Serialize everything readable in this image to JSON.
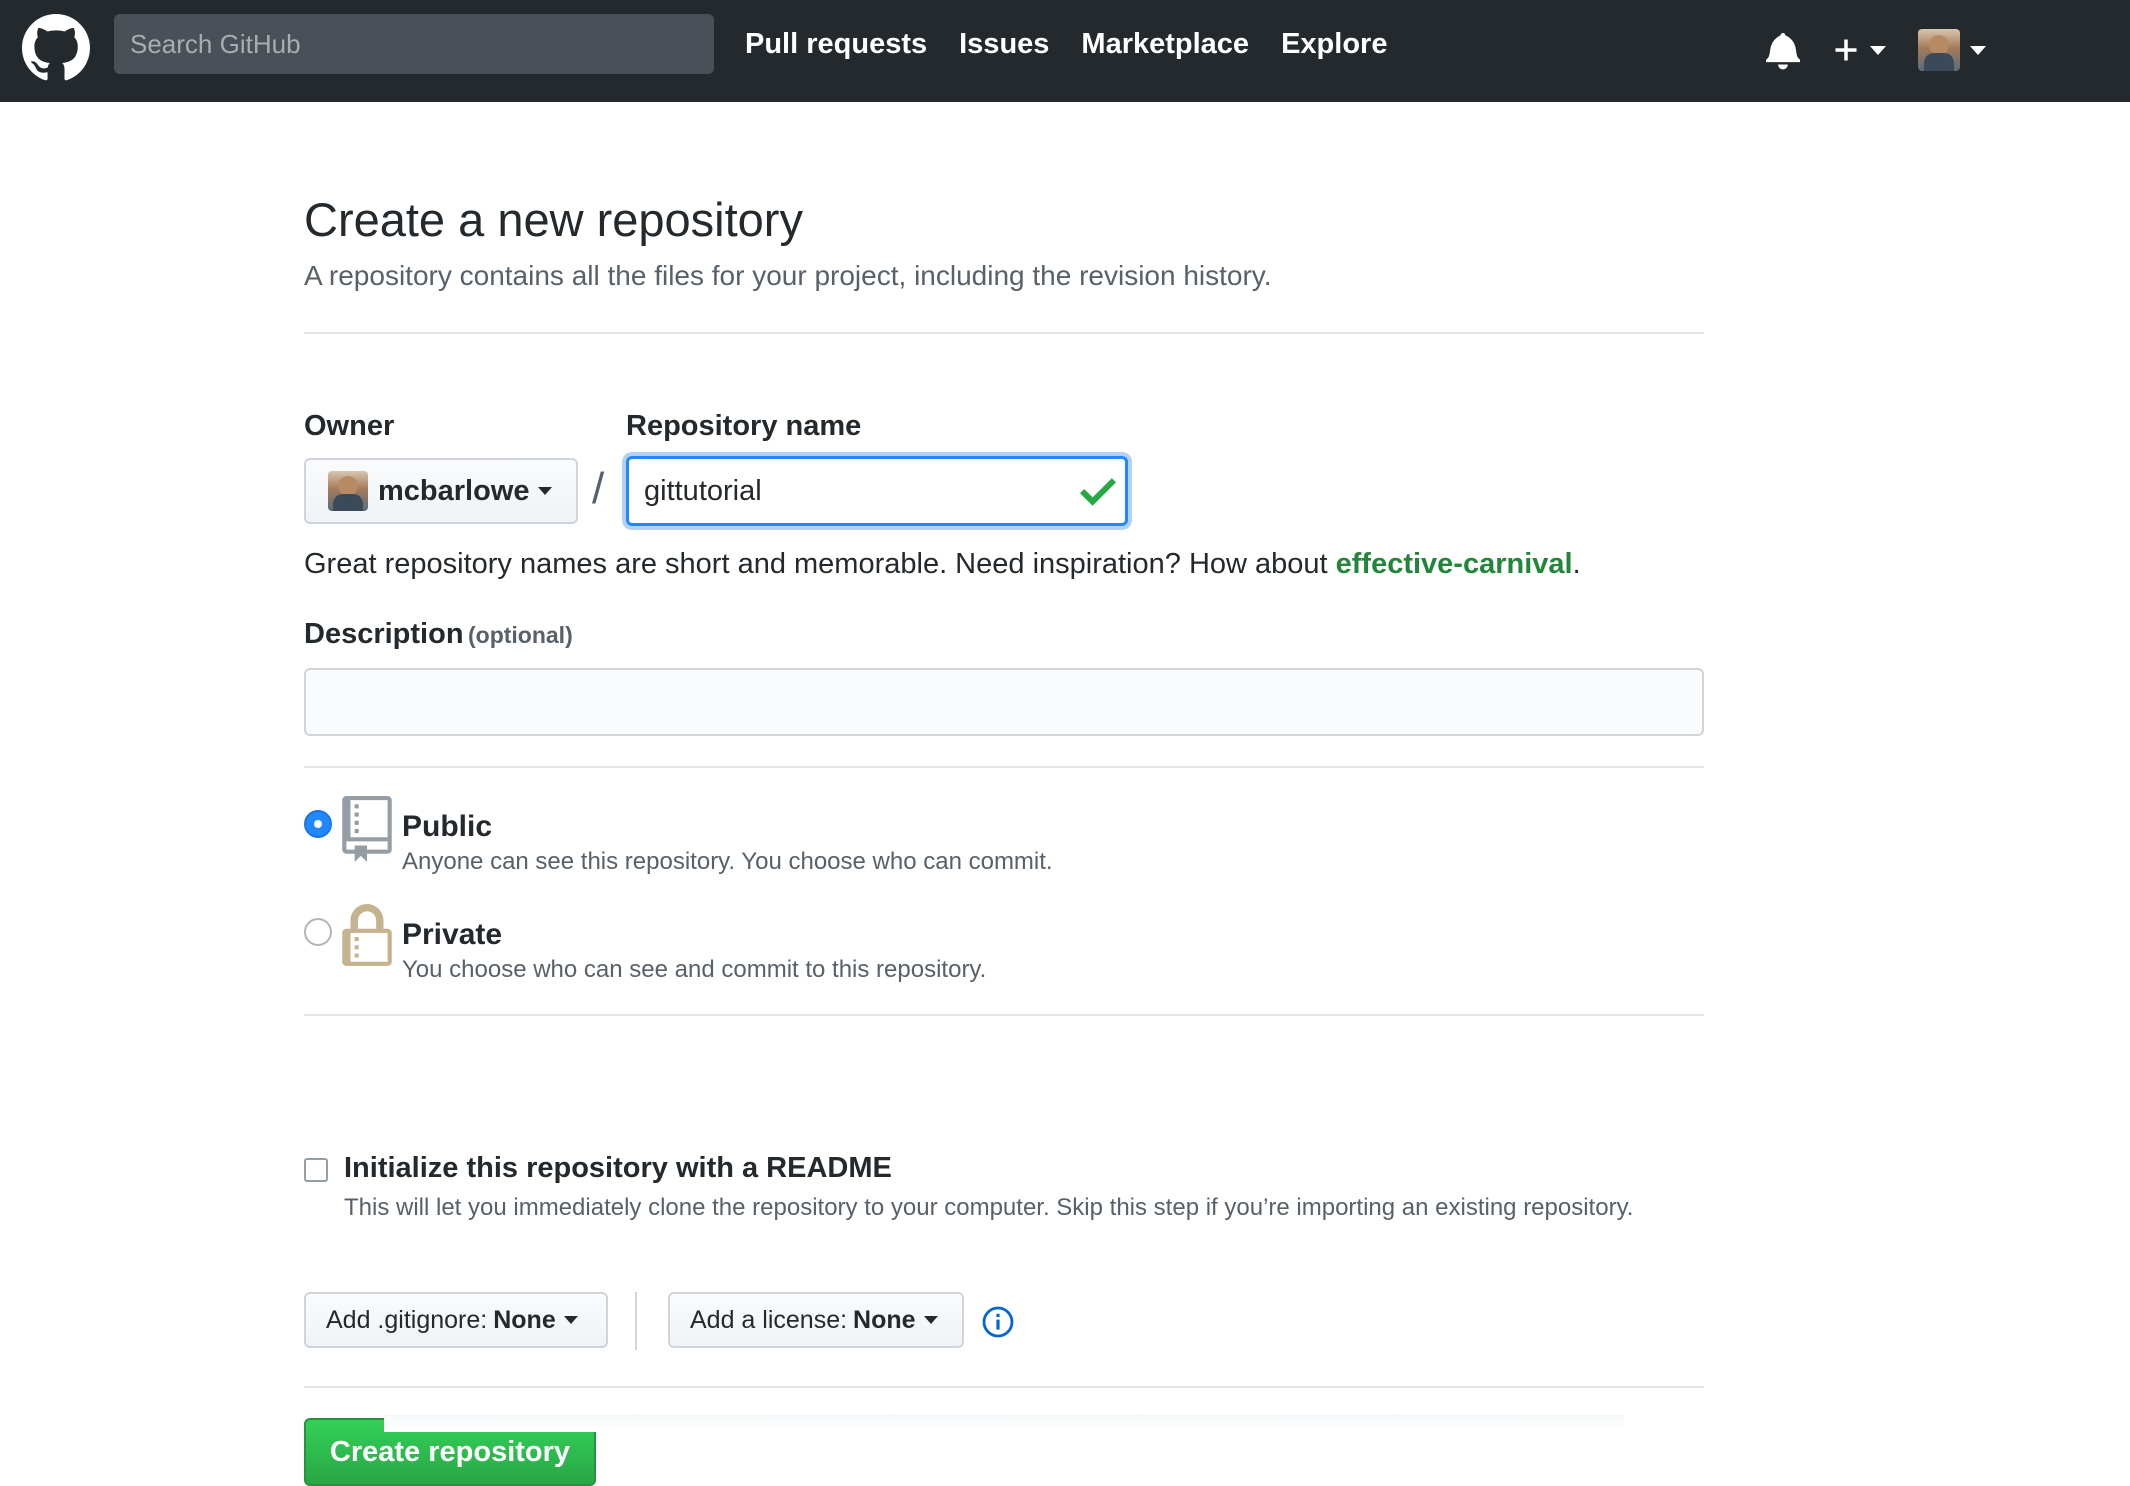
{
  "header": {
    "search_placeholder": "Search GitHub",
    "nav": [
      "Pull requests",
      "Issues",
      "Marketplace",
      "Explore"
    ],
    "bg_color": "#24292e"
  },
  "page": {
    "title": "Create a new repository",
    "subtitle": "A repository contains all the files for your project, including the revision history."
  },
  "form": {
    "owner_label": "Owner",
    "owner_value": "mcbarlowe",
    "separator": "/",
    "repo_label": "Repository name",
    "repo_value": "gittutorial",
    "hint_prefix": "Great repository names are short and memorable. Need inspiration? How about ",
    "hint_suggestion": "effective-carnival",
    "hint_suffix": ".",
    "description_label": "Description",
    "description_optional": "(optional)",
    "description_value": ""
  },
  "visibility": {
    "selected": "public",
    "public_title": "Public",
    "public_desc": "Anyone can see this repository. You choose who can commit.",
    "private_title": "Private",
    "private_desc": "You choose who can see and commit to this repository."
  },
  "init": {
    "checked": false,
    "title": "Initialize this repository with a README",
    "desc": "This will let you immediately clone the repository to your computer. Skip this step if you’re importing an existing repository."
  },
  "selects": {
    "gitignore_prefix": "Add .gitignore:",
    "gitignore_value": "None",
    "license_prefix": "Add a license:",
    "license_value": "None"
  },
  "actions": {
    "create_label": "Create repository"
  },
  "colors": {
    "accent_blue": "#2188ff",
    "success_green": "#28a745",
    "suggestion_green": "#22863a"
  }
}
